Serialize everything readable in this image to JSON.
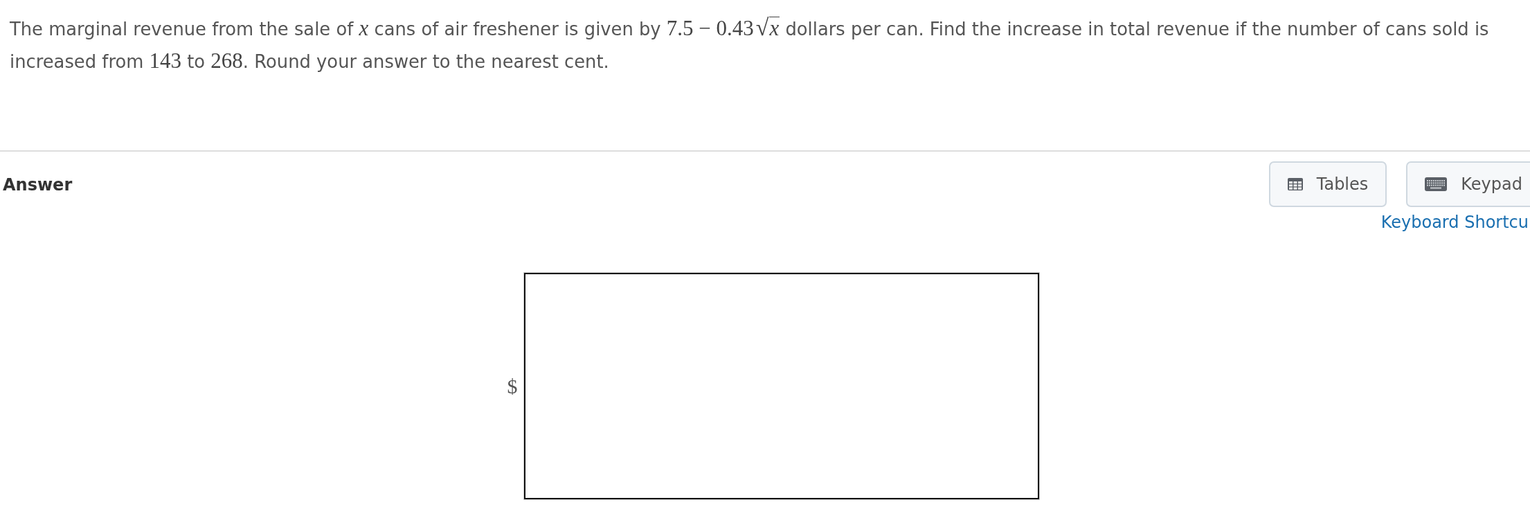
{
  "question": {
    "segments": [
      {
        "kind": "text",
        "text": "The marginal revenue from the sale of "
      },
      {
        "kind": "var",
        "text": "x"
      },
      {
        "kind": "text",
        "text": " cans of air freshener is given by "
      },
      {
        "kind": "num",
        "text": "7.5 − 0.43"
      },
      {
        "kind": "sqrt",
        "sign": "√",
        "text": "x"
      },
      {
        "kind": "text",
        "text": " dollars per can. Find the increase in total revenue if the number of cans sold is increased from "
      },
      {
        "kind": "num",
        "text": "143"
      },
      {
        "kind": "text",
        "text": " to "
      },
      {
        "kind": "num",
        "text": "268"
      },
      {
        "kind": "text",
        "text": ". Round your answer to the nearest cent."
      }
    ]
  },
  "answer_section": {
    "title": "Answer",
    "buttons": [
      {
        "kind": "tables",
        "label": "Tables"
      },
      {
        "kind": "keypad",
        "label": "Keypad"
      }
    ],
    "link": "Keyboard Shortcu"
  },
  "answer": {
    "prefix": "$"
  }
}
